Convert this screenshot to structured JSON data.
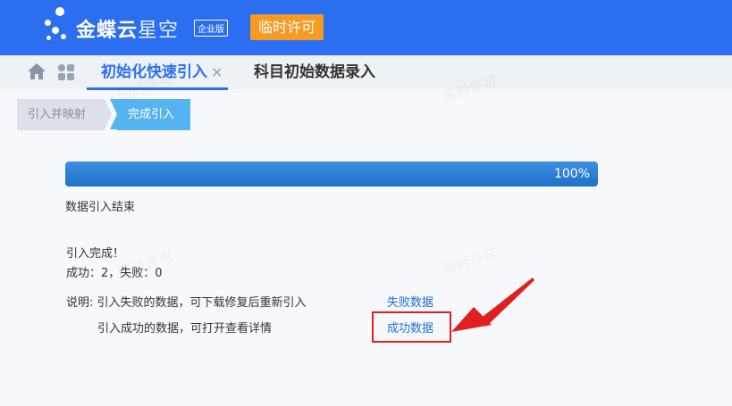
{
  "header": {
    "brand_main": "金蝶云",
    "brand_sub": "星空",
    "edition": "企业版",
    "license_button": "临时许可"
  },
  "tabs": [
    {
      "label": "初始化快速引入",
      "close": "×",
      "active": true
    },
    {
      "label": "科目初始数据录入",
      "active": false
    }
  ],
  "steps": [
    {
      "label": "引入并映射",
      "active": false
    },
    {
      "label": "完成引入",
      "active": true
    }
  ],
  "progress": {
    "percent": 100,
    "label": "100%",
    "status": "数据引入结束"
  },
  "result": {
    "title": "引入完成！",
    "counts": "成功：2，失败：0"
  },
  "notes": {
    "failed_desc": "说明: 引入失败的数据，可下载修复后重新引入",
    "failed_link": "失败数据",
    "success_desc": "引入成功的数据，可打开查看详情",
    "success_link": "成功数据"
  },
  "watermark": "限时许可",
  "colors": {
    "header_bg": "#2b6ff0",
    "license_bg": "#f59a23",
    "step_active": "#55b4f0",
    "progress": "#1d71c9",
    "link": "#1f6fd6",
    "annotation": "#e02020"
  }
}
